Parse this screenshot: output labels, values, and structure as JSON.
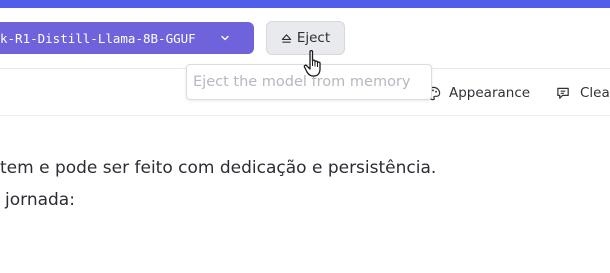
{
  "toolbar": {
    "model_name": "k-R1-Distill-Llama-8B-GGUF",
    "eject_label": "Eject",
    "eject_tooltip": "Eject the model from memory"
  },
  "subbar": {
    "appearance_label": "Appearance",
    "clear_label": "Clea"
  },
  "content": {
    "line1": "tem e pode ser feito com dedicação e persistência.",
    "line2": "jornada:"
  },
  "colors": {
    "accent_bar": "#4f5fe8",
    "model_pill": "#6f63dc",
    "eject_button_bg": "#e8eaee"
  },
  "icons": [
    "chevron-down-icon",
    "eject-icon",
    "palette-icon",
    "clear-chat-icon",
    "hand-pointer-icon"
  ]
}
